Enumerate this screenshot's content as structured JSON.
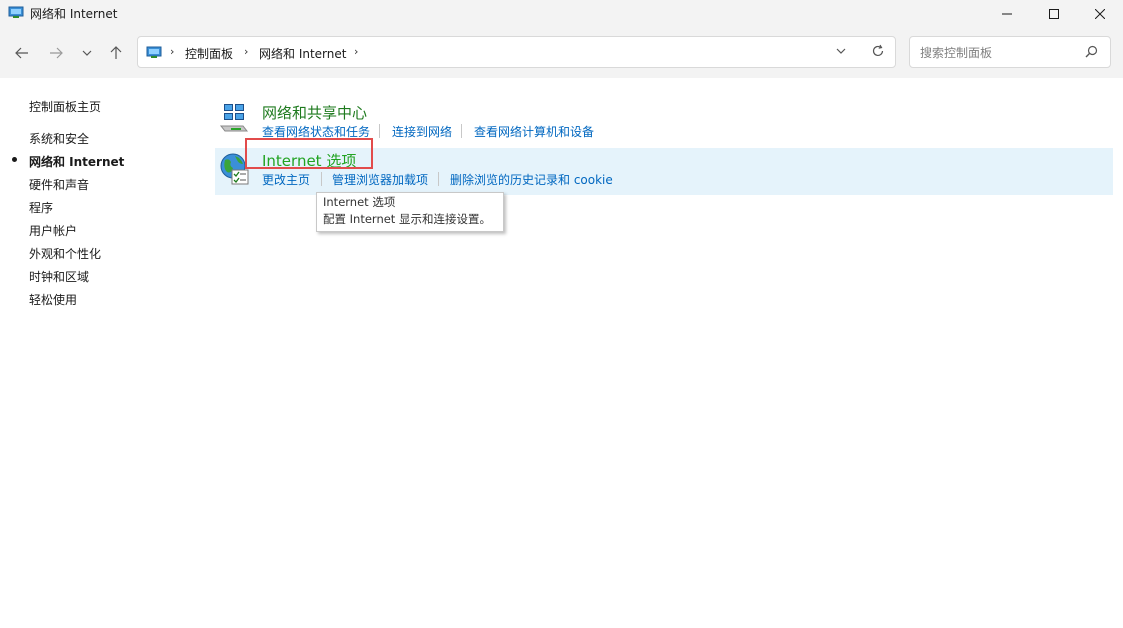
{
  "window": {
    "title": "网络和 Internet",
    "minimize_icon": "minimize-icon",
    "maximize_icon": "maximize-icon",
    "close_icon": "close-icon"
  },
  "nav": {
    "back_icon": "back-arrow-icon",
    "forward_icon": "forward-arrow-icon",
    "recent_icon": "chevron-down-icon",
    "up_icon": "up-arrow-icon"
  },
  "address": {
    "crumbs": [
      "控制面板",
      "网络和 Internet"
    ],
    "dropdown_icon": "chevron-down-icon",
    "refresh_icon": "refresh-icon"
  },
  "search": {
    "placeholder": "搜索控制面板",
    "icon": "search-icon"
  },
  "sidebar": {
    "home": "控制面板主页",
    "items": [
      {
        "label": "系统和安全",
        "active": false
      },
      {
        "label": "网络和 Internet",
        "active": true
      },
      {
        "label": "硬件和声音",
        "active": false
      },
      {
        "label": "程序",
        "active": false
      },
      {
        "label": "用户帐户",
        "active": false
      },
      {
        "label": "外观和个性化",
        "active": false
      },
      {
        "label": "时钟和区域",
        "active": false
      },
      {
        "label": "轻松使用",
        "active": false
      }
    ]
  },
  "categories": [
    {
      "title": "网络和共享中心",
      "icon": "network-sharing-icon",
      "tasks": [
        "查看网络状态和任务",
        "连接到网络",
        "查看网络计算机和设备"
      ]
    },
    {
      "title": "Internet 选项",
      "icon": "internet-options-icon",
      "tasks": [
        "更改主页",
        "管理浏览器加载项",
        "删除浏览的历史记录和 cookie"
      ]
    }
  ],
  "tooltip": {
    "title": "Internet 选项",
    "description": "配置 Internet 显示和连接设置。"
  },
  "colors": {
    "link": "#0067c0",
    "category_title": "#1e7a1e",
    "hover_bg": "#e5f3fb",
    "highlight_border": "#e24b4b"
  }
}
